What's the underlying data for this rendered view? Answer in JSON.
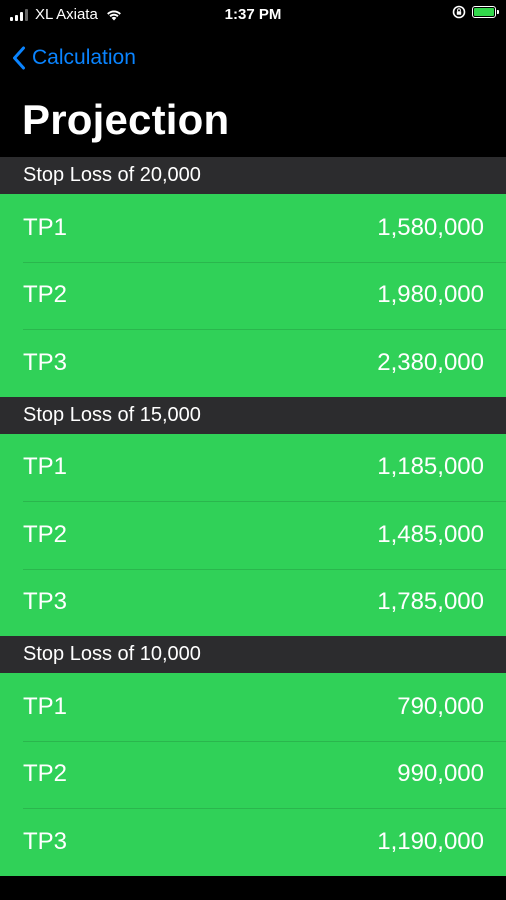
{
  "status_bar": {
    "carrier": "XL Axiata",
    "time": "1:37 PM"
  },
  "nav": {
    "back_label": "Calculation"
  },
  "title": "Projection",
  "sections": [
    {
      "header": "Stop Loss of 20,000",
      "rows": [
        {
          "label": "TP1",
          "value": "1,580,000"
        },
        {
          "label": "TP2",
          "value": "1,980,000"
        },
        {
          "label": "TP3",
          "value": "2,380,000"
        }
      ]
    },
    {
      "header": "Stop Loss of 15,000",
      "rows": [
        {
          "label": "TP1",
          "value": "1,185,000"
        },
        {
          "label": "TP2",
          "value": "1,485,000"
        },
        {
          "label": "TP3",
          "value": "1,785,000"
        }
      ]
    },
    {
      "header": "Stop Loss of 10,000",
      "rows": [
        {
          "label": "TP1",
          "value": "790,000"
        },
        {
          "label": "TP2",
          "value": "990,000"
        },
        {
          "label": "TP3",
          "value": "1,190,000"
        }
      ]
    }
  ],
  "colors": {
    "accent": "#0a84ff",
    "row_background": "#30d158",
    "section_header_background": "#2c2c2e",
    "page_background": "#000000"
  }
}
